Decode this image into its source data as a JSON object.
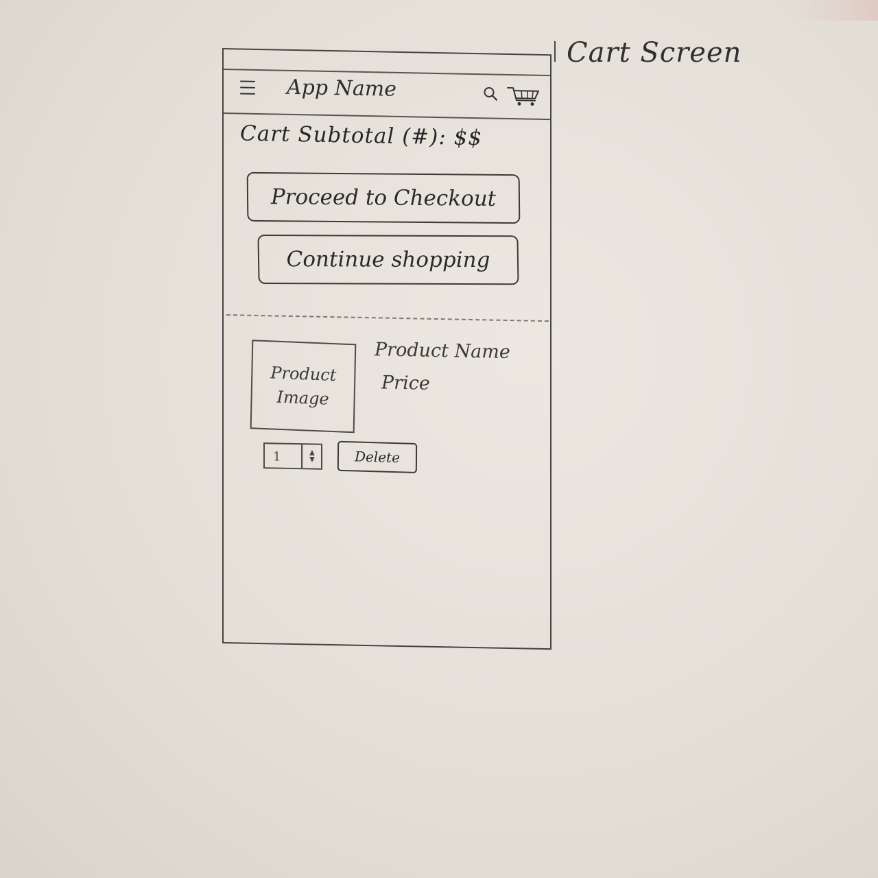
{
  "sketch_title": "Cart Screen",
  "header": {
    "app_name": "App Name",
    "menu_icon": "hamburger-menu-icon",
    "search_icon": "search-icon",
    "cart_icon": "cart-icon"
  },
  "cart": {
    "subtotal_text": "Cart Subtotal (#): $$",
    "checkout_label": "Proceed to Checkout",
    "continue_label": "Continue shopping"
  },
  "item": {
    "image_placeholder": "Product\nImage",
    "name": "Product Name",
    "price": "Price",
    "quantity": "1",
    "delete_label": "Delete"
  }
}
